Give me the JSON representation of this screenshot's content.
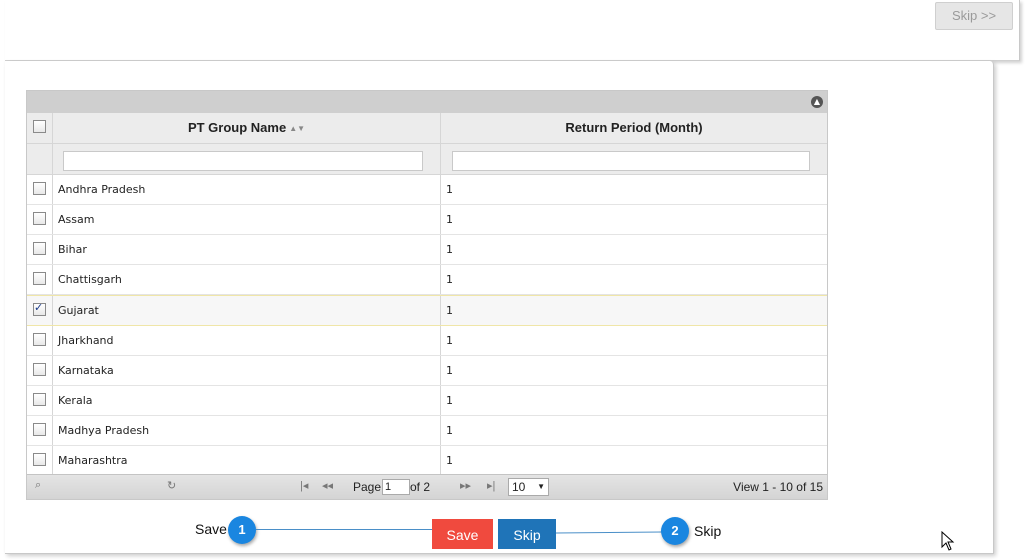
{
  "top": {
    "skip_label": "Skip >>"
  },
  "grid": {
    "columns": [
      "PT Group Name",
      "Return Period (Month)"
    ],
    "rows": [
      {
        "name": "Andhra Pradesh",
        "period": "1",
        "checked": false
      },
      {
        "name": "Assam",
        "period": "1",
        "checked": false
      },
      {
        "name": "Bihar",
        "period": "1",
        "checked": false
      },
      {
        "name": "Chattisgarh",
        "period": "1",
        "checked": false
      },
      {
        "name": "Gujarat",
        "period": "1",
        "checked": true
      },
      {
        "name": "Jharkhand",
        "period": "1",
        "checked": false
      },
      {
        "name": "Karnataka",
        "period": "1",
        "checked": false
      },
      {
        "name": "Kerala",
        "period": "1",
        "checked": false
      },
      {
        "name": "Madhya Pradesh",
        "period": "1",
        "checked": false
      },
      {
        "name": "Maharashtra",
        "period": "1",
        "checked": false
      }
    ],
    "pager": {
      "page_label": "Page",
      "page_value": "1",
      "of_label": "of 2",
      "rows_per_page": "10",
      "view_text": "View 1 - 10 of 15"
    }
  },
  "callouts": {
    "left_label": "Save",
    "left_number": "1",
    "save_button": "Save",
    "skip_button": "Skip",
    "right_number": "2",
    "right_label": "Skip"
  },
  "colors": {
    "save": "#f04a3e",
    "skip": "#1f74b8",
    "badge": "#1a86e0"
  }
}
